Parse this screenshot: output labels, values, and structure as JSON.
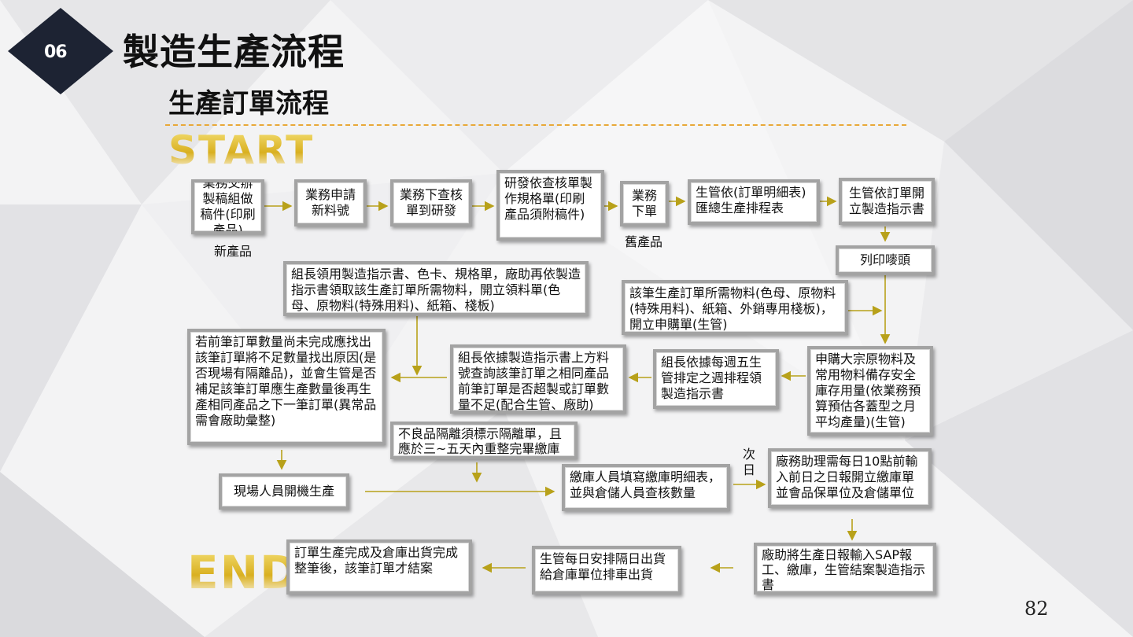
{
  "badge": "06",
  "title": "製造生產流程",
  "subtitle": "生產訂單流程",
  "start_label": "START",
  "end_label": "END",
  "page_number": "82",
  "colors": {
    "accent": "#e8a838",
    "arrow": "#b8a11a",
    "badge": "#1d2333"
  },
  "boxes": {
    "b1": "業務交辦製稿組做稿件(印刷產品)",
    "b2": "業務申請新料號",
    "b3": "業務下查核單到研發",
    "b4": "研發依查核單製作規格單(印刷產品須附稿件)",
    "b5": "業務下單",
    "b6": "生管依(訂單明細表)匯總生產排程表",
    "b7": "生管依訂單開立製造指示書",
    "b8": "列印嘜頭",
    "b9": "組長領用製造指示書、色卡、規格單，廠助再依製造指示書領取該生產訂單所需物料，開立領料單(色母、原物料(特殊用料)、紙箱、棧板)",
    "b10": "該筆生產訂單所需物料(色母、原物料(特殊用料)、紙箱、外銷專用棧板)，開立申購單(生管)",
    "b11": "若前筆訂單數量尚未完成應找出該筆訂單將不足數量找出原因(是否現場有隔離品)，並會生管是否補足該筆訂單應生產數量後再生產相同產品之下一筆訂單(異常品需會廠助彙整)",
    "b12": "組長依據製造指示書上方料號查詢該筆訂單之相同產品前筆訂單是否超製或訂單數量不足(配合生管、廠助)",
    "b13": "組長依據每週五生管排定之週排程領製造指示書",
    "b14": "申購大宗原物料及常用物料備存安全庫存用量(依業務預算預估各蓋型之月平均產量)(生管)",
    "b15": "不良品隔離須標示隔離單，且應於三~五天內重整完畢繳庫",
    "b16": "現場人員開機生產",
    "b17": "繳庫人員填寫繳庫明細表，並與倉儲人員查核數量",
    "b18": "廠務助理需每日10點前輸入前日之日報開立繳庫單並會品保單位及倉儲單位",
    "b19": "訂單生產完成及倉庫出貨完成整筆後，該筆訂單才結案",
    "b20": "生管每日安排隔日出貨給倉庫單位排車出貨",
    "b21": "廠助將生產日報輸入SAP報工、繳庫，生管結案製造指示書"
  },
  "notes": {
    "new_product": "新產品",
    "old_product": "舊產品",
    "next_day": "次日"
  }
}
